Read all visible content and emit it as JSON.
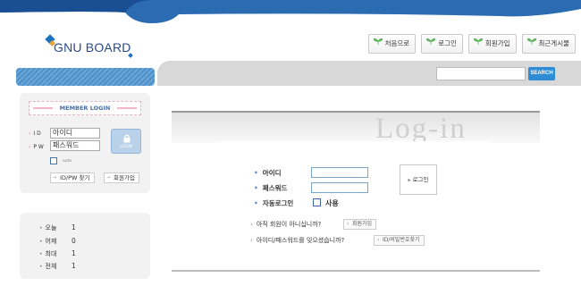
{
  "logo": {
    "text": "GNU BOARD"
  },
  "topnav": [
    {
      "label": "처음으로"
    },
    {
      "label": "로그인"
    },
    {
      "label": "회원가입"
    },
    {
      "label": "최근게시물"
    }
  ],
  "search": {
    "placeholder": "",
    "button": "SEARCH"
  },
  "member_login": {
    "title": "MEMBER LOGIN",
    "id_label": "I D",
    "pw_label": "P W",
    "id_value": "아이디",
    "pw_value": "패스워드",
    "login_button": "LOGIN",
    "auto_label": "auto",
    "find_button": "ID/PW 찾기",
    "join_button": "회원가입"
  },
  "stats": [
    {
      "label": "오늘",
      "value": "1"
    },
    {
      "label": "어제",
      "value": "0"
    },
    {
      "label": "최대",
      "value": "1"
    },
    {
      "label": "전체",
      "value": "1"
    }
  ],
  "main_login": {
    "title": "Log-in",
    "id_label": "아이디",
    "pw_label": "패스워드",
    "auto_label": "자동로그인",
    "use_label": "사용",
    "login_button": "로그인",
    "q1": "아직 회원이 아니십니까?",
    "q1_button": "회원가입",
    "q2": "아이디/패스워드를 잊으셨습니까?",
    "q2_button": "ID/비밀번호찾기"
  },
  "colors": {
    "brand_blue": "#1e73be",
    "accent_pink": "#e07fa1"
  }
}
